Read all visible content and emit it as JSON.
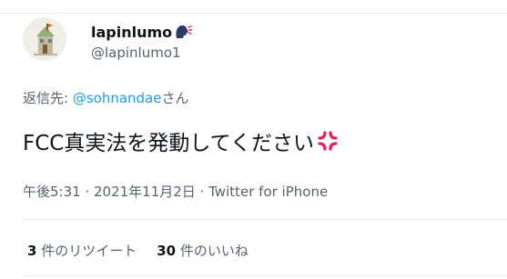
{
  "user": {
    "display_name": "lapinlumo",
    "display_name_emoji": "speaking-head-emoji",
    "handle": "@lapinlumo1",
    "avatar": "house-illustration-avatar"
  },
  "reply": {
    "prefix": "返信先: ",
    "mention": "@sohnandae",
    "suffix": "さん"
  },
  "tweet": {
    "text": "FCC真実法を発動してください",
    "emoji": "anger-symbol-emoji"
  },
  "meta": {
    "time": "午後5:31",
    "date": "2021年11月2日",
    "separator": " · ",
    "source": "Twitter for iPhone"
  },
  "stats": {
    "retweets_count": "3",
    "retweets_label": " 件のリツイート",
    "likes_count": "30",
    "likes_label": " 件のいいね"
  },
  "colors": {
    "text_primary": "#0f1419",
    "text_secondary": "#536471",
    "link": "#1d9bf0",
    "divider": "#ebeef0",
    "anger_red": "#e0245e"
  }
}
